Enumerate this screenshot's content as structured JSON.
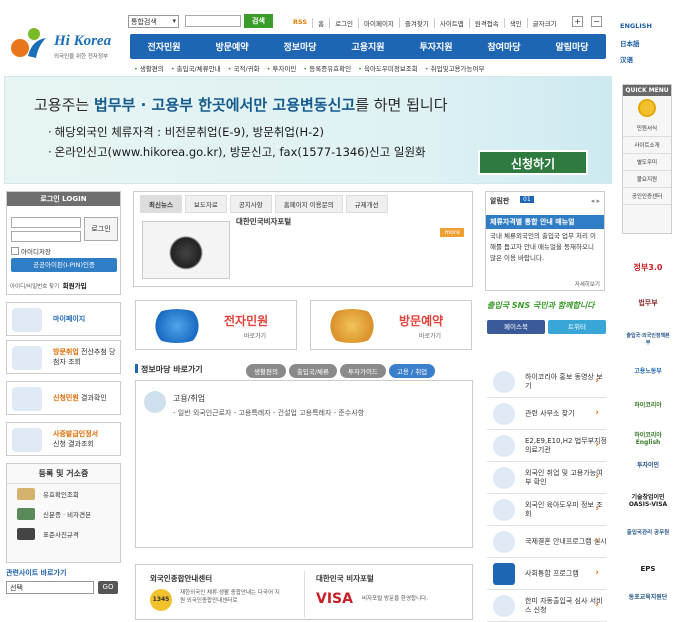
{
  "header": {
    "logo_text": "Hi Korea",
    "logo_sub": "외국인을 위한 전자정부",
    "search_select": "통합검색",
    "search_button": "검색",
    "top_links": [
      "RSS",
      "홈",
      "로그인",
      "마이페이지",
      "즐겨찾기",
      "사이트맵",
      "원격접속",
      "색인",
      "글자크기"
    ],
    "zoom_in": "+",
    "zoom_out": "−"
  },
  "languages": [
    "ENGLISH",
    "日本語",
    "汉语"
  ],
  "main_nav": [
    "전자민원",
    "방문예약",
    "정보마당",
    "고용지원",
    "투자지원",
    "참여마당",
    "알림마당"
  ],
  "sub_nav": [
    "생활편의",
    "출입국/체류안내",
    "국적/귀화",
    "투자이민",
    "등록증유효확인",
    "육아도우미정보조회",
    "취업및고용가능여부"
  ],
  "banner": {
    "headline_pre": "고용주는",
    "headline_bold": "법무부 · 고용부 한곳에서만 고용변동신고",
    "headline_post": "를 하면 됩니다",
    "line1": "해당외국인 체류자격 : 비전문취업(E-9), 방문취업(H-2)",
    "line2": "온라인신고(www.hikorea.go.kr), 방문신고, fax(1577-1346)신고 일원화",
    "button": "신청하기"
  },
  "quick_menu": {
    "title": "QUICK MENU",
    "items": [
      "민원서식",
      "사이트소개",
      "별도우미",
      "불요지원",
      "공인인증센터"
    ]
  },
  "org_banners": [
    "정부3.0",
    "법무부",
    "출입국·외국인정책본부",
    "고용노동부",
    "하이코리아",
    "하이코리아 English",
    "투자이민",
    "기술창업이민 OASIS-VISA",
    "출입국관리 공무원",
    "EPS",
    "동포교육지원단"
  ],
  "login": {
    "title": "로그인 LOGIN",
    "button": "로그인",
    "remember": "아이디저장",
    "ipin": "공공아이핀(I-PIN)인증",
    "find": "아이디/비밀번호 찾기",
    "signup": "회원가입"
  },
  "left_links": [
    {
      "title": "마이페이지",
      "sub": ""
    },
    {
      "title": "방문취업",
      "sub": "전산추첨 당첨자 조회"
    },
    {
      "title": "신청민원",
      "sub": "결과확인"
    },
    {
      "title": "사증발급인정서",
      "sub": "신청 결과조회"
    }
  ],
  "doc": {
    "title": "등록 및 거소증",
    "items": [
      "유효확인조회",
      "신분증 · 비자견본",
      "표준사진규격"
    ]
  },
  "related": {
    "title": "관련사이트 바로가기",
    "select": "선택",
    "go": "GO"
  },
  "news": {
    "tabs": [
      "최신뉴스",
      "보도자료",
      "공지사항",
      "홈페이지 이용문의",
      "규제개선"
    ],
    "title": "대한민국비자포털",
    "more": "more"
  },
  "big_buttons": [
    {
      "label": "전자민원",
      "sub": "바로가기"
    },
    {
      "label": "방문예약",
      "sub": "바로가기"
    }
  ],
  "info": {
    "title": "정보마당 바로가기",
    "tabs": [
      "생활편의",
      "출입국/체류",
      "투자가이드",
      "고용 / 취업"
    ],
    "category": "고용/취업",
    "tags": "- 일반 외국인근로자 - 고용특례자 - 건설업 고용특례자 - 준수사항"
  },
  "cards": {
    "c1_title": "외국인종합안내센터",
    "c1_sub": "재한외국인 체류·생활 종합안내는\n다국어 지원 외국인종합안내센터로",
    "c1_num": "1345",
    "c2_title": "대한민국 비자포털",
    "c2_sub": "비자포털 방문을 환영합니다.",
    "c2_logo": "VISA"
  },
  "notice": {
    "tab": "알림판",
    "num": "01",
    "headline": "체류자격별 통합 안내 매뉴얼",
    "body": "국내 체류외국인의 출입국 업무 처리 이해를 돕고자 안내 매뉴얼을 등재하오니 많은 이용 바랍니다.",
    "link": "자세히보기"
  },
  "slogan": "출입국 SNS 국민과 함께합니다",
  "social": [
    "페이스북",
    "트위터"
  ],
  "services": [
    "하이코리아 홍보 동영상 보기",
    "관련 사무소 찾기",
    "E2,E9,E10,H2 법무부지정 의료기관",
    "외국인 취업 및 고용가능여부 확인",
    "외국인 육아도우미 정보 조회",
    "국제결혼 안내프로그램 실시",
    "사회통합 프로그램",
    "한미 자동출입국 심사 서비스 신청"
  ]
}
